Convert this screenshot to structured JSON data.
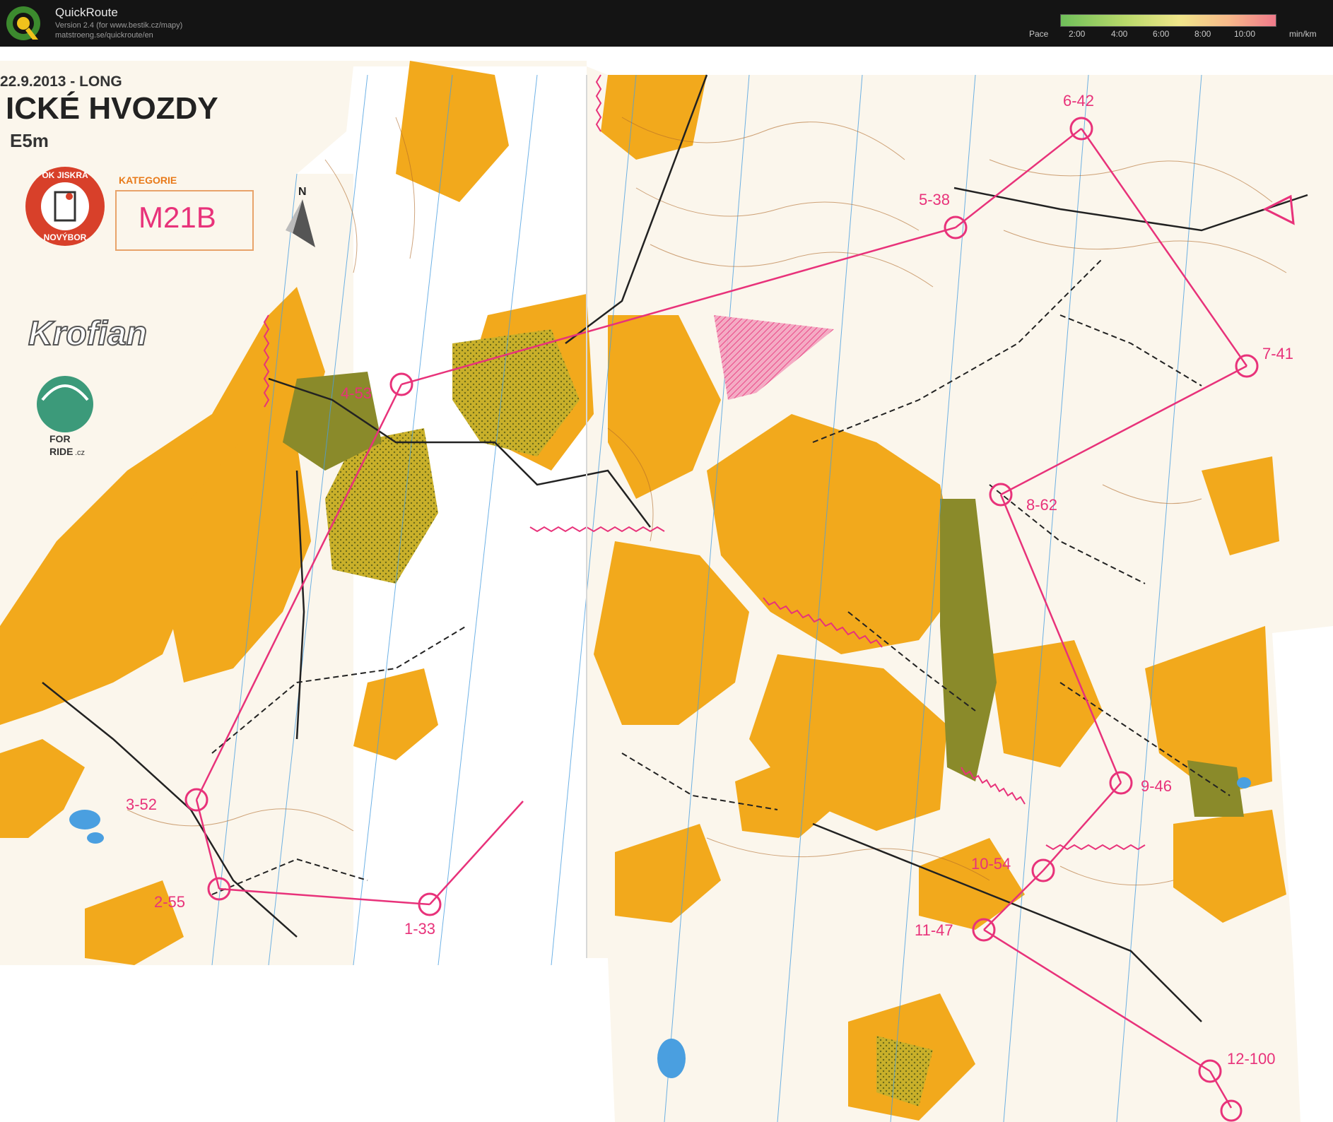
{
  "app": {
    "title": "QuickRoute",
    "version_line": "Version 2.4  (for www.bestik.cz/mapy)",
    "url_line": "matstroeng.se/quickroute/en"
  },
  "pace_scale": {
    "label": "Pace",
    "ticks": [
      "2:00",
      "4:00",
      "6:00",
      "8:00",
      "10:00"
    ],
    "unit": "min/km",
    "gradient_colors": [
      "#6fbf5a",
      "#b9d96a",
      "#f0e68a",
      "#f7b98a",
      "#f07a8a"
    ]
  },
  "map_header": {
    "date_line": "22.9.2013  -  LONG",
    "title": "ICKÉ HVOZDY",
    "scale_line": "E5m",
    "category_label": "KATEGORIE",
    "category": "M21B",
    "club_top": "OK JISKRA",
    "club_bottom": "NOVÝBOR",
    "sponsor": "Krofian",
    "sponsor2_top": "FOR",
    "sponsor2_mid": "RIDE",
    "sponsor2_tld": ".cz",
    "north_label": "N"
  },
  "controls": [
    {
      "label": "1-33"
    },
    {
      "label": "2-55"
    },
    {
      "label": "3-52"
    },
    {
      "label": "4-53"
    },
    {
      "label": "5-38"
    },
    {
      "label": "6-42"
    },
    {
      "label": "7-41"
    },
    {
      "label": "8-62"
    },
    {
      "label": "9-46"
    },
    {
      "label": "10-54"
    },
    {
      "label": "11-47"
    },
    {
      "label": "12-100"
    }
  ],
  "colors": {
    "course": "#e8327a",
    "open_land": "#f2a91c",
    "green": "#8a8a2a",
    "water": "#4a9fe0",
    "contour": "#b06a2a",
    "path": "#222222"
  }
}
